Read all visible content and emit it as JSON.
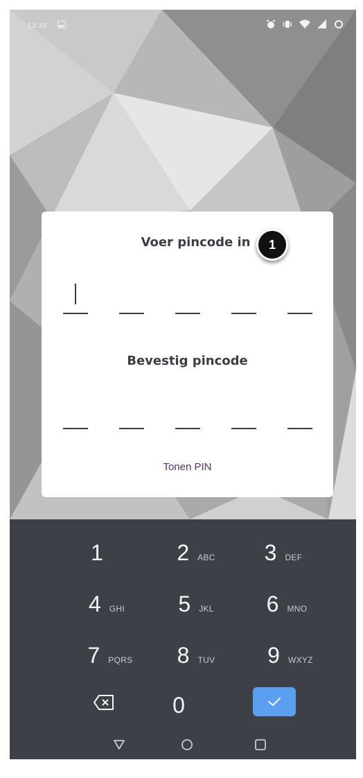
{
  "status_bar": {
    "time": "13:15",
    "icons": [
      "image-icon",
      "alarm-icon",
      "vibrate-icon",
      "wifi-icon",
      "signal-icon",
      "sync-icon"
    ]
  },
  "dialog": {
    "title": "Voer pincode in",
    "badge_number": "1",
    "confirm_title": "Bevestig pincode",
    "show_pin_label": "Tonen PIN",
    "pin_length": 5
  },
  "keypad": {
    "keys": [
      {
        "digit": "1",
        "letters": ""
      },
      {
        "digit": "2",
        "letters": "ABC"
      },
      {
        "digit": "3",
        "letters": "DEF"
      },
      {
        "digit": "4",
        "letters": "GHI"
      },
      {
        "digit": "5",
        "letters": "JKL"
      },
      {
        "digit": "6",
        "letters": "MNO"
      },
      {
        "digit": "7",
        "letters": "PQRS"
      },
      {
        "digit": "8",
        "letters": "TUV"
      },
      {
        "digit": "9",
        "letters": "WXYZ"
      },
      {
        "digit": "0",
        "letters": ""
      }
    ],
    "enter_icon": "check-icon",
    "backspace_icon": "backspace-icon"
  },
  "navigation": {
    "buttons": [
      "back-icon",
      "home-icon",
      "recents-icon"
    ]
  },
  "colors": {
    "keypad_bg": "#3d4147",
    "enter_key": "#5a9ff0",
    "show_pin_text": "#5b2a6e",
    "title_text": "#3b3f45"
  }
}
